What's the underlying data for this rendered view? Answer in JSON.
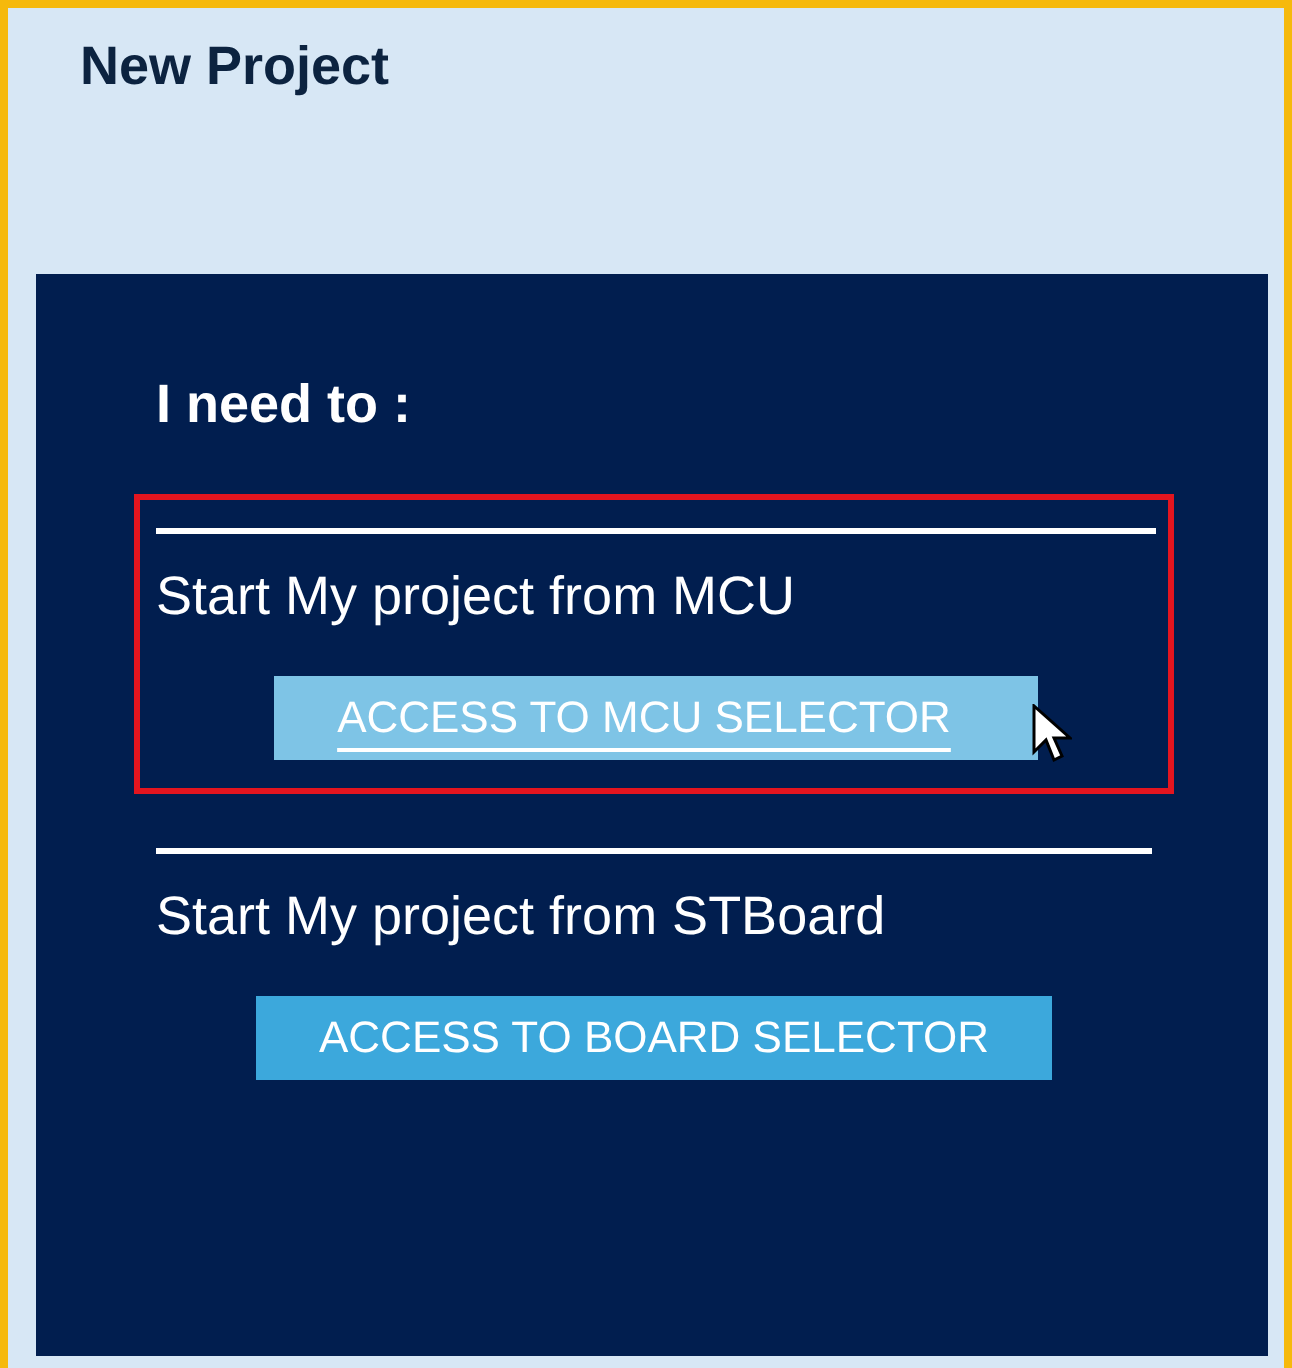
{
  "title": "New Project",
  "panel": {
    "heading": "I need to :",
    "options": [
      {
        "label": "Start My project from MCU",
        "button": "ACCESS TO MCU SELECTOR",
        "highlighted": true,
        "hovered": true
      },
      {
        "label": "Start My project from STBoard",
        "button": "ACCESS TO BOARD SELECTOR",
        "highlighted": false,
        "hovered": false
      }
    ]
  }
}
